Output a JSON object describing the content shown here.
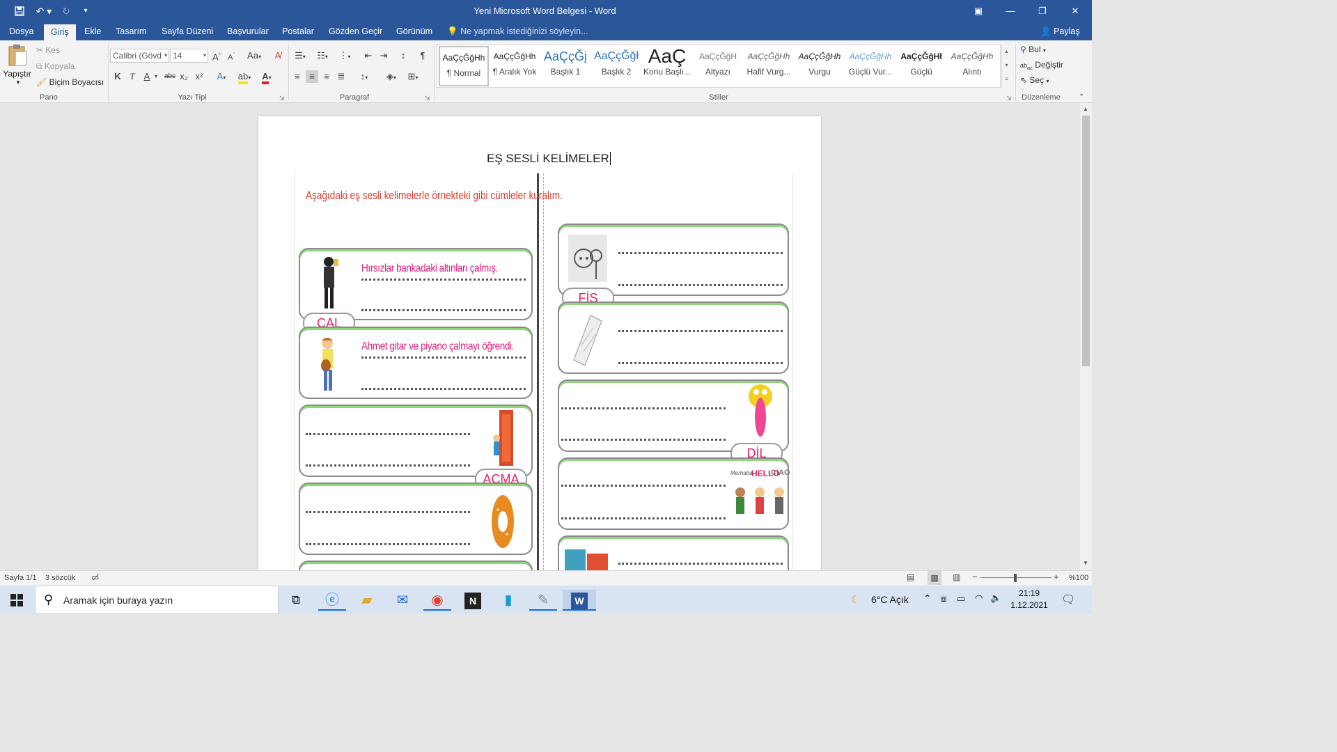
{
  "window": {
    "title": "Yeni Microsoft Word Belgesi - Word"
  },
  "qat": {
    "save_icon": "save-icon",
    "undo_icon": "undo-icon",
    "redo_icon": "redo-icon",
    "customize_icon": "chevron-down-icon"
  },
  "tabs": [
    {
      "label": "Dosya"
    },
    {
      "label": "Giriş"
    },
    {
      "label": "Ekle"
    },
    {
      "label": "Tasarım"
    },
    {
      "label": "Sayfa Düzeni"
    },
    {
      "label": "Başvurular"
    },
    {
      "label": "Postalar"
    },
    {
      "label": "Gözden Geçir"
    },
    {
      "label": "Görünüm"
    }
  ],
  "tellme": {
    "text": "Ne yapmak istediğinizi söyleyin..."
  },
  "share": {
    "label": "Paylaş"
  },
  "ribbon": {
    "clipboard": {
      "paste": "Yapıştır",
      "cut": "Kes",
      "copy": "Kopyala",
      "format_painter": "Biçim Boyacısı",
      "group": "Pano"
    },
    "font": {
      "name": "Calibri (Gövd",
      "size": "14",
      "case": "Aa",
      "bold": "K",
      "italic": "T",
      "underline": "A",
      "strike": "abc",
      "sub": "x₂",
      "sup": "x²",
      "group": "Yazı Tipi"
    },
    "paragraph": {
      "group": "Paragraf"
    },
    "styles": {
      "group": "Stiller",
      "items": [
        {
          "preview": "AaÇçĞğHh",
          "name": "¶ Normal"
        },
        {
          "preview": "AaÇçĞğHh",
          "name": "¶ Aralık Yok"
        },
        {
          "preview": "AaÇçĞį",
          "name": "Başlık 1"
        },
        {
          "preview": "AaÇçĞğł",
          "name": "Başlık 2"
        },
        {
          "preview": "AaÇ",
          "name": "Konu Başlı..."
        },
        {
          "preview": "AaÇçĞğH",
          "name": "Altyazı"
        },
        {
          "preview": "AaÇçĞğHh",
          "name": "Hafif Vurg..."
        },
        {
          "preview": "AaÇçĞğHh",
          "name": "Vurgu"
        },
        {
          "preview": "AaÇçĞğHh",
          "name": "Güçlü Vur..."
        },
        {
          "preview": "AaÇçĞğHł",
          "name": "Güçlü"
        },
        {
          "preview": "AaÇçĞğHh",
          "name": "Alıntı"
        }
      ]
    },
    "editing": {
      "find": "Bul",
      "replace": "Değiştir",
      "select": "Seç",
      "group": "Düzenleme"
    }
  },
  "document": {
    "heading": "EŞ SESLİ KELİMELER",
    "instruction": "Aşağıdaki eş sesli kelimelerle örnekteki gibi  cümleler kuralım.",
    "left": [
      {
        "word": "ÇAL",
        "sentence": "Hırsızlar bankadaki altınları çalmış."
      },
      {
        "word": "",
        "sentence": "Ahmet gitar ve piyano çalmayı öğrendi."
      },
      {
        "word": "AÇMA",
        "sentence": ""
      },
      {
        "word": "",
        "sentence": ""
      }
    ],
    "right": [
      {
        "word": "FİŞ"
      },
      {
        "word": ""
      },
      {
        "word": "DİL"
      },
      {
        "word": ""
      },
      {
        "word": ""
      }
    ],
    "bubble_words": [
      "Merhaba",
      "HELLO",
      "CIAO"
    ]
  },
  "status": {
    "page": "Sayfa 1/1",
    "words": "3 sözcük",
    "zoom": "%100"
  },
  "taskbar": {
    "search_placeholder": "Aramak için buraya yazın",
    "weather": "6°C  Açık",
    "time": "21:19",
    "date": "1.12.2021"
  }
}
